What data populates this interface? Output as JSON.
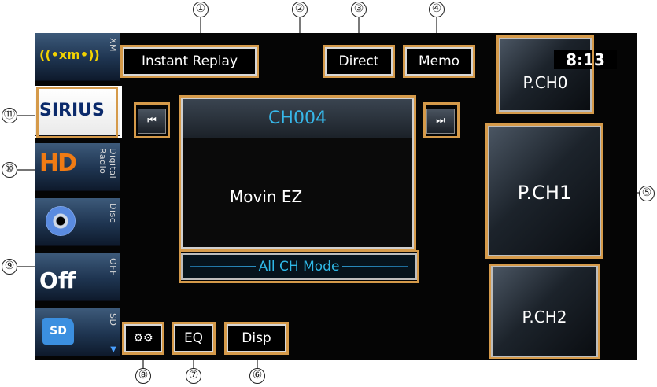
{
  "callouts": [
    "①",
    "②",
    "③",
    "④",
    "⑤",
    "⑥",
    "⑦",
    "⑧",
    "⑨",
    "⑩",
    "⑪"
  ],
  "sidebar": {
    "sources": [
      {
        "label": "XM",
        "logo": "((•xm•))",
        "icon": "xm-radio-icon"
      },
      {
        "label": "",
        "logo": "SIRIUS",
        "icon": "sirius-logo-icon",
        "active": true
      },
      {
        "label": "Digital Radio",
        "logo": "HD",
        "icon": "hd-radio-icon"
      },
      {
        "label": "Disc",
        "logo": "",
        "icon": "disc-icon"
      },
      {
        "label": "OFF",
        "logo": "Off",
        "icon": "off-icon"
      },
      {
        "label": "SD",
        "logo": "SD",
        "icon": "sd-card-icon"
      }
    ],
    "scroll_glyph": "▼"
  },
  "toolbar": {
    "instant_replay": "Instant Replay",
    "direct": "Direct",
    "memo": "Memo"
  },
  "player": {
    "channel": "CH004",
    "song": "Movin EZ",
    "prev_glyph": "⏮",
    "next_glyph": "⏭",
    "mode": "All CH Mode"
  },
  "bottom": {
    "settings_icon": "gear-icon",
    "settings_glyph": "⚙⚙",
    "eq": "EQ",
    "disp": "Disp"
  },
  "presets": {
    "p0": "P.CH0",
    "p1": "P.CH1",
    "p2": "P.CH2"
  },
  "status": {
    "clock": "8:13"
  },
  "colors": {
    "accent_blue": "#37b8ea",
    "callout_border": "#d59a4a"
  }
}
